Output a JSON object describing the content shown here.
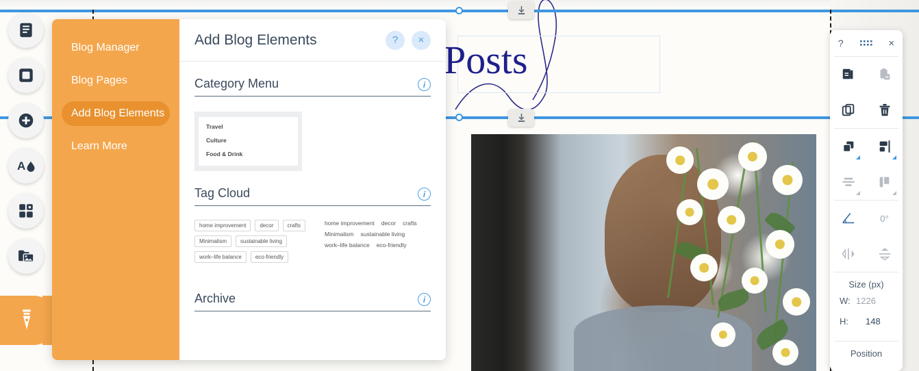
{
  "canvas": {
    "heading": "Posts",
    "photo_alt": "woman-with-daisies-photo"
  },
  "left_rail": {
    "items": [
      {
        "name": "pages-icon",
        "label": "Pages"
      },
      {
        "name": "background-icon",
        "label": "Background"
      },
      {
        "name": "add-icon",
        "label": "Add"
      },
      {
        "name": "design-icon",
        "label": "Design"
      },
      {
        "name": "apps-icon",
        "label": "Apps"
      },
      {
        "name": "media-icon",
        "label": "My Designs"
      }
    ],
    "blog_tab": {
      "name": "blog-pen-icon",
      "label": "Blog"
    }
  },
  "panel": {
    "title": "Add Blog Elements",
    "help_label": "?",
    "close_label": "×",
    "nav": [
      {
        "label": "Blog Manager",
        "active": false
      },
      {
        "label": "Blog Pages",
        "active": false
      },
      {
        "label": "Add Blog Elements",
        "active": true
      },
      {
        "label": "Learn More",
        "active": false
      }
    ],
    "sections": [
      {
        "title": "Category Menu",
        "info": "i"
      },
      {
        "title": "Tag Cloud",
        "info": "i"
      },
      {
        "title": "Archive",
        "info": "i"
      }
    ],
    "category_preview": [
      "Travel",
      "Culture",
      "Food & Drink"
    ],
    "tag_preview": {
      "row1": [
        "home improvement",
        "decor",
        "crafts"
      ],
      "row2": [
        "Minimalism",
        "sustainable living"
      ],
      "row3": [
        "work–life balance",
        "eco-friendly"
      ]
    }
  },
  "float_toolbar": {
    "help_label": "?",
    "close_label": "×",
    "grip_label": "drag-grip",
    "actions": [
      {
        "name": "copy-style-icon",
        "label": "Copy Style"
      },
      {
        "name": "paste-style-icon",
        "label": "Paste Style"
      },
      {
        "name": "duplicate-icon",
        "label": "Duplicate"
      },
      {
        "name": "delete-icon",
        "label": "Delete"
      }
    ],
    "arrange": [
      {
        "name": "arrange-order-icon",
        "label": "Arrange"
      },
      {
        "name": "align-horizontal-icon",
        "label": "Align Horizontal"
      },
      {
        "name": "distribute-vertical-icon",
        "label": "Distribute Vertical"
      },
      {
        "name": "align-vertical-icon",
        "label": "Align Vertical"
      }
    ],
    "rotate": {
      "name": "rotate-angle-icon",
      "value": "0°"
    },
    "flips": [
      {
        "name": "flip-horizontal-icon",
        "label": "Flip Horizontal"
      },
      {
        "name": "flip-vertical-icon",
        "label": "Flip Vertical"
      }
    ],
    "size": {
      "label": "Size (px)",
      "width_key": "W:",
      "width_value": "1226",
      "height_key": "H:",
      "height_value": "148"
    },
    "position": {
      "label": "Position"
    }
  },
  "colors": {
    "orange": "#f4a64c",
    "orange_active": "#e8912e",
    "blue_accent": "#3f97e0",
    "heading_navy": "#1f1f8c",
    "slate": "#3a4a5c"
  }
}
